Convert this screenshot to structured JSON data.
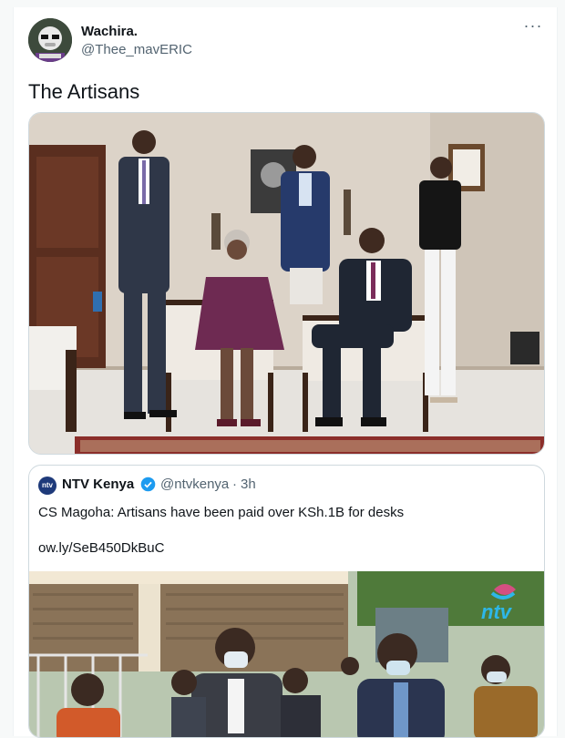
{
  "tweet": {
    "author_name": "Wachira.",
    "author_handle": "@Thee_mavERIC",
    "more_label": "···",
    "text": "The Artisans"
  },
  "quoted_tweet": {
    "logo_text": "ntv",
    "author_name": "NTV Kenya",
    "author_handle": "@ntvkenya",
    "separator": "·",
    "time": "3h",
    "text": "CS Magoha: Artisans have been paid over KSh.1B for desks",
    "link": "ow.ly/SeB450DkBuC",
    "watermark": "ntv"
  },
  "colors": {
    "accent": "#1d9bf0",
    "secondary_text": "#536471",
    "border": "#cfd9de"
  },
  "icons": {
    "more": "more-dots-icon",
    "verified": "verified-badge-icon"
  }
}
